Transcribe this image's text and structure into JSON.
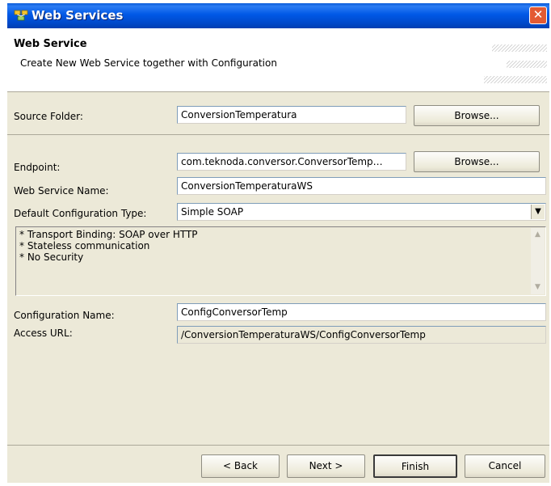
{
  "window": {
    "title": "Web Services",
    "close_glyph": "✕"
  },
  "header": {
    "title": "Web Service",
    "description": "Create New Web Service together with Configuration"
  },
  "form": {
    "source_folder": {
      "label": "Source Folder:",
      "value": "ConversionTemperatura",
      "browse": "Browse..."
    },
    "endpoint": {
      "label": "Endpoint:",
      "value": "com.teknoda.conversor.ConversorTemp…",
      "browse": "Browse..."
    },
    "service_name": {
      "label": "Web Service Name:",
      "value": "ConversionTemperaturaWS"
    },
    "config_type": {
      "label": "Default Configuration Type:",
      "value": "Simple SOAP"
    },
    "config_description": [
      "* Transport Binding: SOAP over HTTP",
      "* Stateless communication",
      "* No Security"
    ],
    "config_name": {
      "label": "Configuration Name:",
      "value": "ConfigConversorTemp"
    },
    "access_url": {
      "label": "Access URL:",
      "value": "/ConversionTemperaturaWS/ConfigConversorTemp"
    }
  },
  "footer": {
    "back": "< Back",
    "next": "Next >",
    "finish": "Finish",
    "cancel": "Cancel"
  }
}
